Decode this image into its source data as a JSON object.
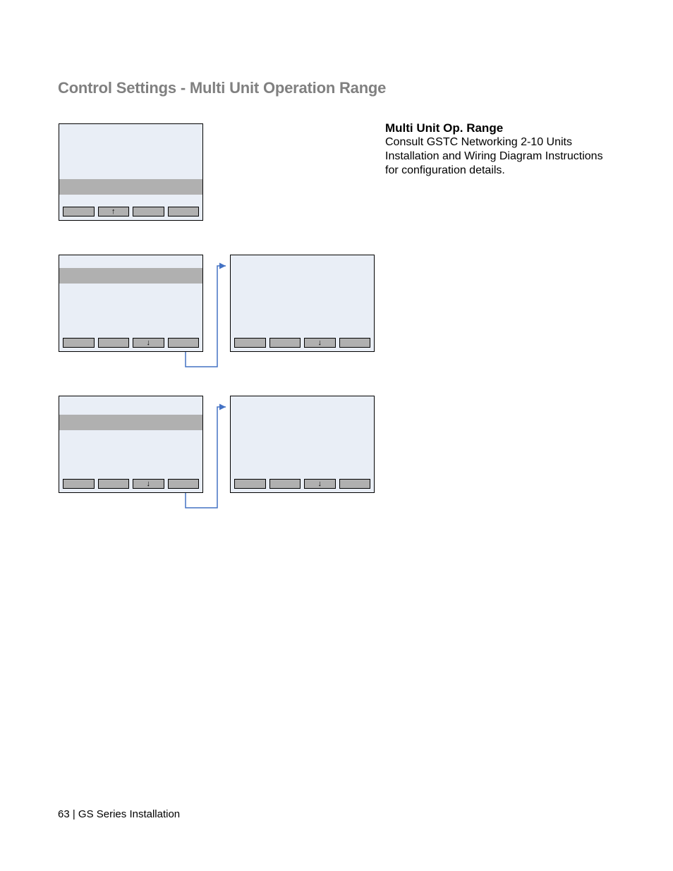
{
  "title": "Control Settings  -  Multi Unit Operation Range",
  "section": {
    "heading": "Multi Unit Op. Range",
    "body": "Consult GSTC Networking 2-10 Units Installation and Wiring Diagram Instructions for configuration details."
  },
  "panels": {
    "p1": {
      "arrowButtonIndex": 1,
      "arrowGlyph": "↑"
    },
    "p2": {
      "arrowButtonIndex": 2,
      "arrowGlyph": "↓"
    },
    "p3": {
      "arrowButtonIndex": 2,
      "arrowGlyph": "↓"
    },
    "p4": {
      "arrowButtonIndex": 2,
      "arrowGlyph": "↓"
    },
    "p5": {
      "arrowButtonIndex": 2,
      "arrowGlyph": "↓"
    }
  },
  "footer": "63 | GS Series Installation",
  "arrowColor": "#4472c4"
}
